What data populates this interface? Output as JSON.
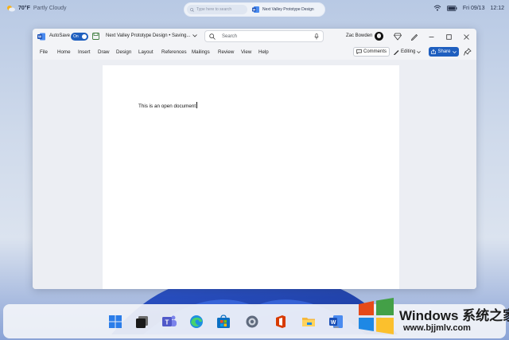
{
  "status_bar": {
    "weather_temp": "70°F",
    "weather_condition": "Partly Cloudy",
    "search_placeholder": "Type here to search",
    "search_result": "Next Valley Prototype Design",
    "date": "Fri 09/13",
    "time": "12:12"
  },
  "word": {
    "autosave_label": "AutoSave",
    "autosave_state": "On",
    "doc_title": "Next Valley Prototype Design • Saving...",
    "search_placeholder": "Search",
    "user_name": "Zac Bowden",
    "menu": [
      "File",
      "Home",
      "Insert",
      "Draw",
      "Design",
      "Layout",
      "References",
      "Mailings",
      "Review",
      "View",
      "Help"
    ],
    "comments_label": "Comments",
    "editing_label": "Editing",
    "share_label": "Share",
    "document_text": "This is an open document"
  },
  "taskbar": {
    "apps": [
      "windows-start-icon",
      "terminal-icon",
      "teams-icon",
      "edge-icon",
      "store-icon",
      "settings-icon",
      "office-icon",
      "file-explorer-icon",
      "word-icon"
    ]
  },
  "watermark": {
    "brand": "Windows 系统之家",
    "url": "www.bjjmlv.com"
  },
  "colors": {
    "accent": "#1f5fbf",
    "window_bg": "#f3f4f7",
    "page_bg": "#ffffff"
  }
}
